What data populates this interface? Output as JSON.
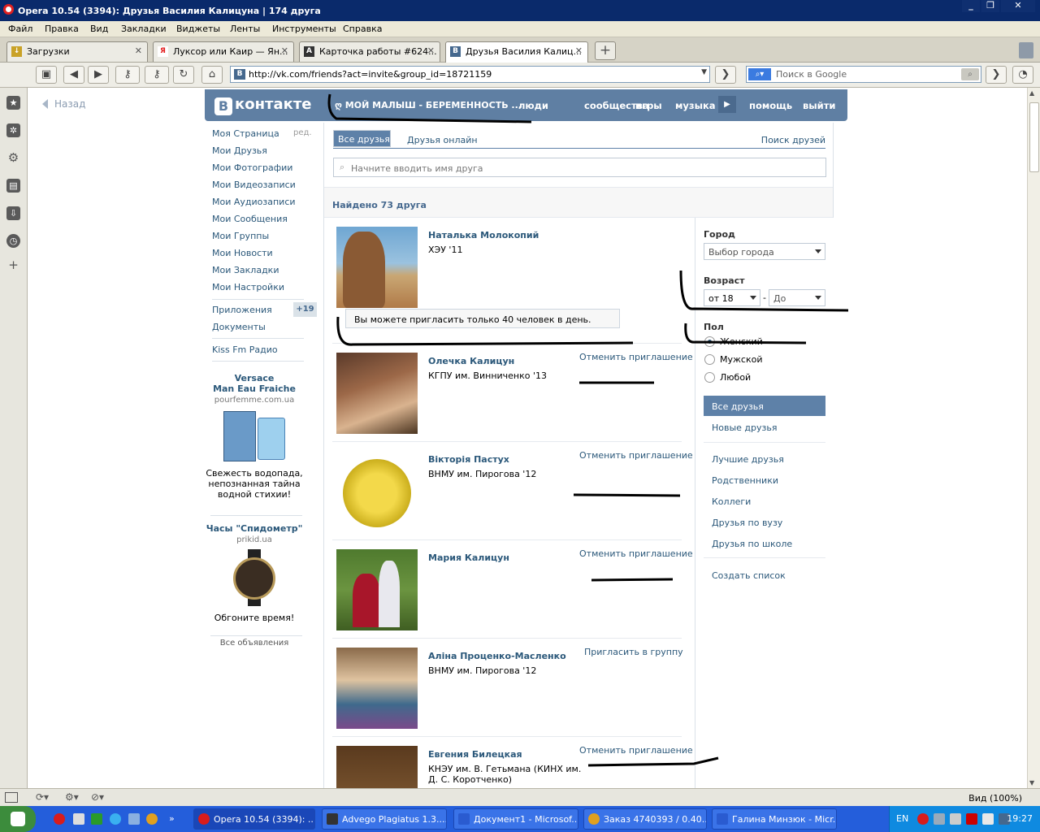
{
  "window": {
    "title": "Opera 10.54 (3394): Друзья Василия Калицуна | 174 друга",
    "controls": [
      "_",
      "❐",
      "✕"
    ]
  },
  "menu": [
    "Файл",
    "Правка",
    "Вид",
    "Закладки",
    "Виджеты",
    "Ленты",
    "Инструменты",
    "Справка"
  ],
  "tabs": [
    {
      "label": "Загрузки",
      "favicon": "download-icon"
    },
    {
      "label": "Луксор или Каир — Ян...",
      "favicon": "yandex-icon"
    },
    {
      "label": "Карточка работы #624...",
      "favicon": "advego-icon"
    },
    {
      "label": "Друзья Василия Калиц...",
      "favicon": "vk-icon"
    }
  ],
  "address": {
    "url": "http://vk.com/friends?act=invite&group_id=18721159",
    "search_placeholder": "Поиск в Google"
  },
  "vk": {
    "logo_text": "контакте",
    "logo_letter": "В",
    "nav_group": "ღ МОЙ МАЛЫШ - БЕРЕМЕННОСТЬ ...",
    "nav": [
      "люди",
      "сообщества",
      "игры",
      "музыка",
      "помощь",
      "выйти"
    ],
    "back": "Назад",
    "edit": "ред.",
    "left_menu": [
      "Моя Страница",
      "Мои Друзья",
      "Мои Фотографии",
      "Мои Видеозаписи",
      "Мои Аудиозаписи",
      "Мои Сообщения",
      "Мои Группы",
      "Мои Новости",
      "Мои Закладки",
      "Мои Настройки"
    ],
    "apps": "Приложения",
    "apps_badge": "+19",
    "documents": "Документы",
    "kiss": "Kiss Fm Радио",
    "ad1": {
      "title": "Versace\nMan Eau Fraiche",
      "t1": "Versace",
      "t2": "Man Eau Fraiche",
      "src": "pourfemme.com.ua",
      "text": "Свежесть водопада, непознанная тайна водной стихии!"
    },
    "ad2": {
      "title": "Часы \"Спидометр\"",
      "src": "prikid.ua",
      "text": "Обгоните время!"
    },
    "all_ads": "Все объявления"
  },
  "content": {
    "tab_all": "Все друзья",
    "tab_online": "Друзья онлайн",
    "find_friends": "Поиск друзей",
    "search_placeholder": "Начните вводить имя друга",
    "found": "Найдено 73 друга",
    "limit_msg": "Вы можете пригласить только 40 человек в день.",
    "friends": [
      {
        "name": "Наталька Молокопий",
        "uni": "ХЭУ '11",
        "action": ""
      },
      {
        "name": "Олечка Калицун",
        "uni": "КГПУ им. Винниченко '13",
        "action": "Отменить приглашение"
      },
      {
        "name": "Вікторія Пастух",
        "uni": "ВНМУ им. Пирогова '12",
        "action": "Отменить приглашение"
      },
      {
        "name": "Мария Калицун",
        "uni": "",
        "action": "Отменить приглашение"
      },
      {
        "name": "Аліна Проценко-Масленко",
        "uni": "ВНМУ им. Пирогова '12",
        "action": "Пригласить в группу"
      },
      {
        "name": "Евгения Билецкая",
        "uni": "КНЭУ им. В. Гетьмана (КИНХ им. Д. С. Коротченко)",
        "action": "Отменить приглашение"
      }
    ]
  },
  "filters": {
    "city_label": "Город",
    "city_value": "Выбор города",
    "age_label": "Возраст",
    "age_from": "от 18",
    "age_dash": "-",
    "age_to": "До",
    "sex_label": "Пол",
    "sex_options": [
      "Женский",
      "Мужской",
      "Любой"
    ],
    "sex_selected": 0,
    "lists": [
      "Все друзья",
      "Новые друзья",
      "Лучшие друзья",
      "Родственники",
      "Коллеги",
      "Друзья по вузу",
      "Друзья по школе",
      "Создать список"
    ]
  },
  "status": {
    "zoom": "Вид (100%)"
  },
  "taskbar": {
    "items": [
      "Opera 10.54 (3394): ...",
      "Advego Plagiatus 1.3....",
      "Документ1 - Microsof...",
      "Заказ 4740393 / 0.40....",
      "Галина Минзюк - Micr..."
    ],
    "lang": "EN",
    "time": "19:27"
  }
}
